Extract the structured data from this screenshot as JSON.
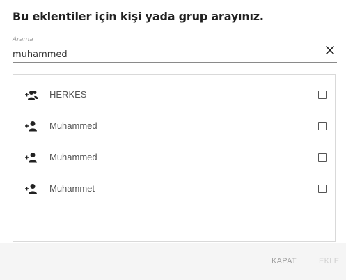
{
  "dialog": {
    "title": "Bu eklentiler için kişi yada grup arayınız."
  },
  "search": {
    "label": "Arama",
    "value": "muhammed",
    "clear_icon": "close-icon"
  },
  "results": [
    {
      "label": "HERKES",
      "icon": "add-group-icon",
      "checked": false
    },
    {
      "label": "Muhammed",
      "icon": "add-person-icon",
      "checked": false
    },
    {
      "label": "Muhammed",
      "icon": "add-person-icon",
      "checked": false
    },
    {
      "label": "Muhammet",
      "icon": "add-person-icon",
      "checked": false
    }
  ],
  "footer": {
    "close_label": "KAPAT",
    "add_label": "EKLE"
  }
}
